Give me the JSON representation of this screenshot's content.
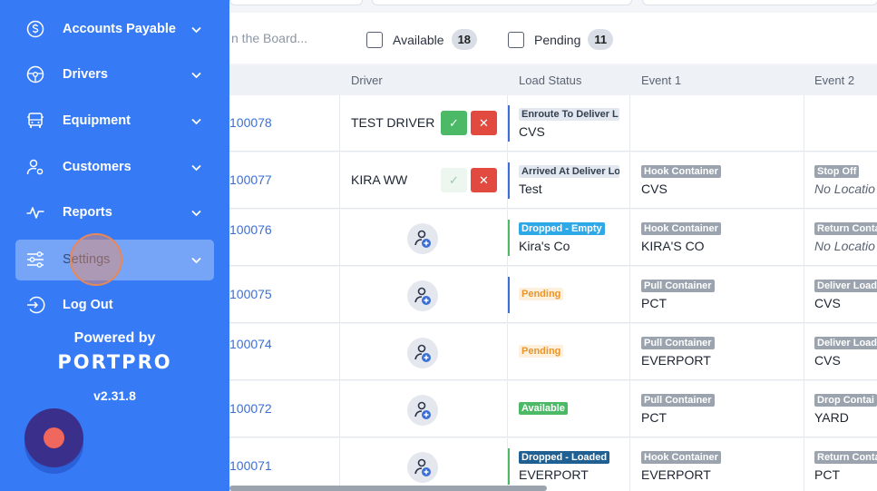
{
  "sidebar": {
    "items": [
      {
        "label": "Accounts Payable",
        "icon": "dollar-circle-icon"
      },
      {
        "label": "Drivers",
        "icon": "steering-wheel-icon"
      },
      {
        "label": "Equipment",
        "icon": "truck-icon"
      },
      {
        "label": "Customers",
        "icon": "user-gear-icon"
      },
      {
        "label": "Reports",
        "icon": "pulse-chart-icon"
      },
      {
        "label": "Settings",
        "icon": "sliders-icon",
        "active": true
      },
      {
        "label": "Log Out",
        "icon": "logout-icon"
      }
    ],
    "powered_by": "Powered by",
    "brand": "PORTPRO",
    "version": "v2.31.8"
  },
  "filter": {
    "search_placeholder": "n the Board...",
    "available_label": "Available",
    "available_count": "18",
    "pending_label": "Pending",
    "pending_count": "11"
  },
  "table": {
    "columns": [
      "Driver",
      "Load Status",
      "Event 1",
      "Event 2"
    ],
    "rows": [
      {
        "load": "100078",
        "driver": "TEST DRIVER",
        "status": "Enroute To Deliver L",
        "status_sub": "CVS",
        "e1_tag": "",
        "e1_sub": "",
        "e2_tag": "",
        "e2_sub": ""
      },
      {
        "load": "100077",
        "driver": "KIRA WW",
        "status": "Arrived At Deliver Lo",
        "status_sub": "Test",
        "e1_tag": "Hook Container",
        "e1_sub": "CVS",
        "e2_tag": "Stop Off",
        "e2_sub": "No Locatio"
      },
      {
        "load": "100076",
        "driver": "",
        "status": "Dropped - Empty",
        "status_sub": "Kira's Co",
        "e1_tag": "Hook Container",
        "e1_sub": "KIRA'S CO",
        "e2_tag": "Return Conta",
        "e2_sub": "No Locatio"
      },
      {
        "load": "100075",
        "driver": "",
        "status": "Pending",
        "status_sub": "",
        "e1_tag": "Pull Container",
        "e1_sub": "PCT",
        "e2_tag": "Deliver Load",
        "e2_sub": "CVS"
      },
      {
        "load": "100074",
        "driver": "",
        "status": "Pending",
        "status_sub": "",
        "e1_tag": "Pull Container",
        "e1_sub": "EVERPORT",
        "e2_tag": "Deliver Load",
        "e2_sub": "CVS"
      },
      {
        "load": "100072",
        "driver": "",
        "status": "Available",
        "status_sub": "",
        "e1_tag": "Pull Container",
        "e1_sub": "PCT",
        "e2_tag": "Drop Contai",
        "e2_sub": "YARD"
      },
      {
        "load": "100071",
        "driver": "",
        "status": "Dropped - Loaded",
        "status_sub": "EVERPORT",
        "e1_tag": "Hook Container",
        "e1_sub": "EVERPORT",
        "e2_tag": "Return Conta",
        "e2_sub": "PCT"
      }
    ]
  },
  "colors": {
    "sidebar": "#367bf5",
    "link": "#3b6fd6",
    "success": "#4cb967",
    "danger": "#e34a3f"
  }
}
